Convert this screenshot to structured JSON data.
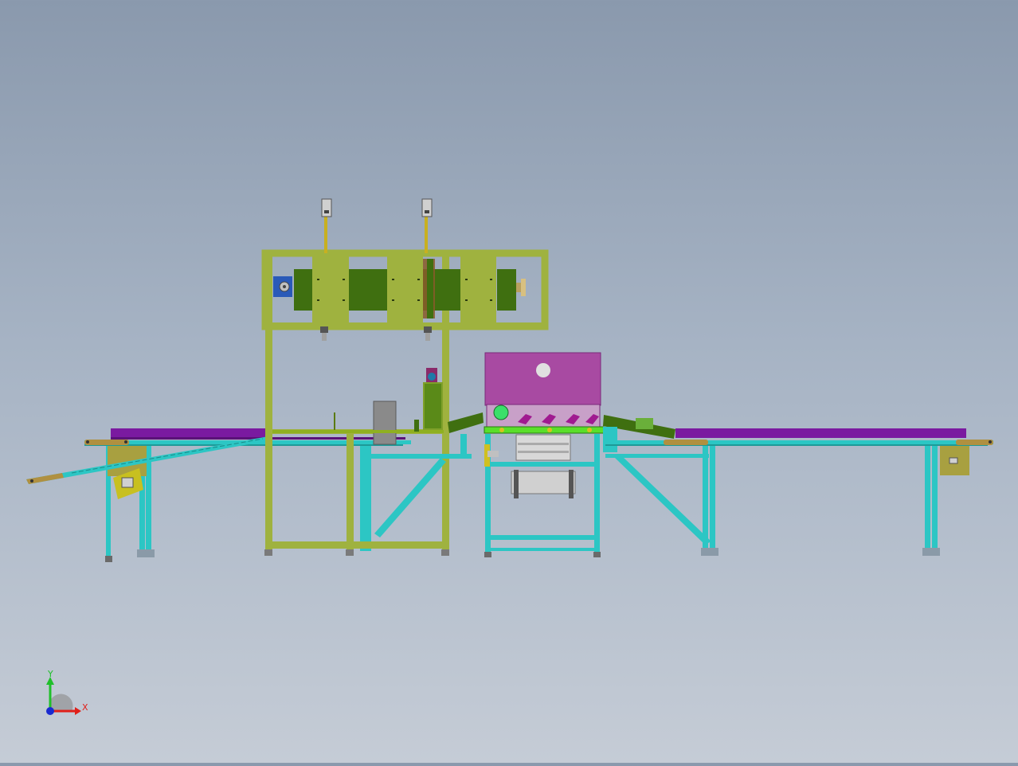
{
  "viewport": {
    "background_top": "#8a99ad",
    "background_bottom": "#c5ccd6"
  },
  "triad": {
    "x_label": "X",
    "y_label": "Y",
    "x_color": "#e0201a",
    "y_color": "#1fbf2a",
    "z_color": "#1a2ad0"
  },
  "model_colors": {
    "frame": "#9fb23f",
    "frame_dark": "#7f942b",
    "panel": "#3f6f10",
    "extrusion": "#2cc6c4",
    "belt": "#7a1aa0",
    "housing": "#a84aa2",
    "roller": "#c8c8c8",
    "brown": "#8a5a2a",
    "blue_motor": "#2a5ab8",
    "olive": "#a8a040",
    "green_tube": "#5adf2a",
    "gray_box": "#8a8a8a"
  }
}
